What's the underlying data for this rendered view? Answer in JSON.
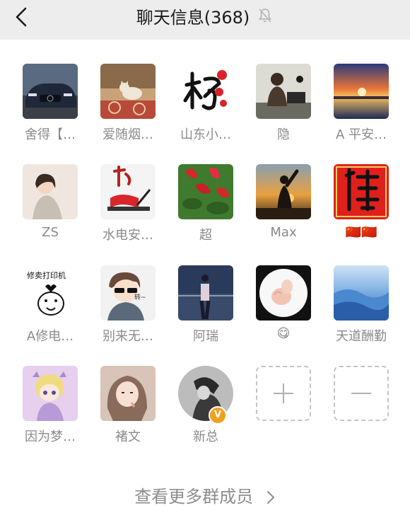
{
  "header": {
    "title": "聊天信息(368)",
    "back_icon": "chevron-left-icon",
    "mute_icon": "bell-muted-icon"
  },
  "members": [
    {
      "name": "舍得【…",
      "avatar": "car-photo"
    },
    {
      "name": "爱随烟…",
      "avatar": "cat-photo"
    },
    {
      "name": "山东小…",
      "avatar": "calligraphy-flower"
    },
    {
      "name": "隐",
      "avatar": "man-at-desk"
    },
    {
      "name": "A 平安…",
      "avatar": "sunset-lake"
    },
    {
      "name": "ZS",
      "avatar": "girl-portrait"
    },
    {
      "name": "水电安…",
      "avatar": "calligraphy-flag"
    },
    {
      "name": "超",
      "avatar": "red-flowers"
    },
    {
      "name": "Max",
      "avatar": "sunset-silhouette"
    },
    {
      "name": "🇨🇳🇨🇳",
      "avatar": "red-calligraphy"
    },
    {
      "name": "A修电…",
      "avatar": "cartoon-printer"
    },
    {
      "name": "别来无…",
      "avatar": "cartoon-boy"
    },
    {
      "name": "阿瑞",
      "avatar": "night-balcony"
    },
    {
      "name": "😋",
      "avatar": "baby-hand"
    },
    {
      "name": "天道酬勤",
      "avatar": "blue-desert"
    },
    {
      "name": "因为梦…",
      "avatar": "anime-girl"
    },
    {
      "name": "褚文",
      "avatar": "girl-photo"
    },
    {
      "name": "新总",
      "avatar": "grey-portrait",
      "badge": "V"
    }
  ],
  "actions": {
    "add_icon": "plus-icon",
    "remove_icon": "minus-icon"
  },
  "footer": {
    "more_label": "查看更多群成员",
    "more_icon": "chevron-right-icon"
  },
  "colors": {
    "header_bg": "#ededed",
    "label": "#8a8a8a",
    "dashed_border": "#c4c4c4",
    "verified_badge": "#f0a020"
  }
}
